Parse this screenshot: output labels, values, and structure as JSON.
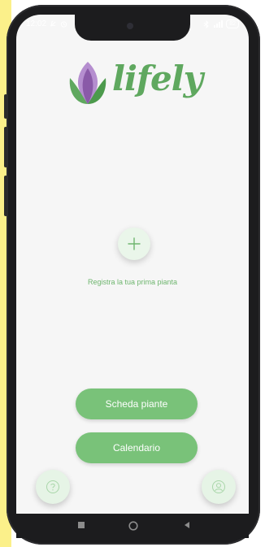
{
  "status_bar": {
    "time": "12:02",
    "left_icons": [
      "mute-icon",
      "alarm-icon"
    ],
    "right_icons": [
      "bluetooth-icon",
      "wifi-icon",
      "signal-icon"
    ],
    "battery": "82"
  },
  "app": {
    "logo_text": "lifely",
    "add_plant_hint": "Registra la tua prima pianta",
    "buttons": {
      "plants_sheet": "Scheda piante",
      "calendar": "Calendario"
    },
    "help_icon": "question-icon",
    "profile_icon": "user-icon"
  },
  "colors": {
    "brand_green": "#5fa85f",
    "button_green": "#79c279",
    "logo_purple": "#8a5aa8",
    "screen_bg": "#f6f6f6"
  },
  "nav_bar": {
    "icons": [
      "recent-apps-icon",
      "home-icon",
      "back-icon"
    ]
  }
}
